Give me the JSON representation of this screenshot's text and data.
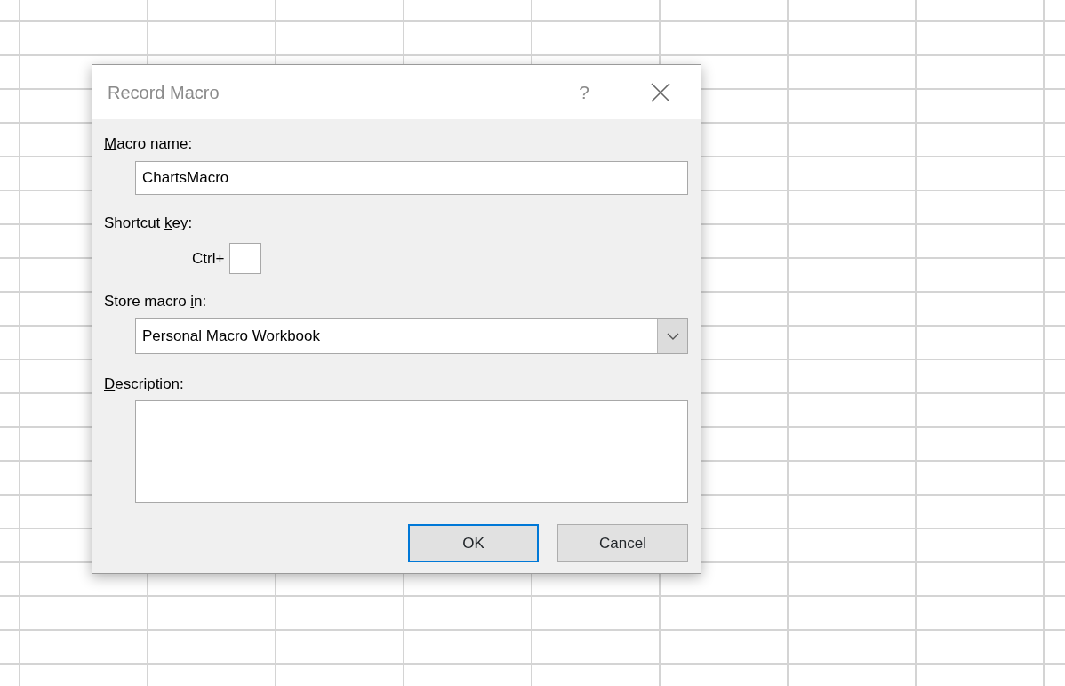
{
  "window": {
    "title": "Record Macro",
    "help": "?"
  },
  "fields": [
    {
      "kind": "text",
      "label": {
        "key": "M",
        "after": "acro name:"
      },
      "value": "ChartsMacro"
    },
    {
      "kind": "shortcut",
      "label": {
        "before": "Shortcut ",
        "key": "k",
        "after": "ey:"
      },
      "prefix": "Ctrl+"
    },
    {
      "kind": "select",
      "label": {
        "before": "Store macro ",
        "key": "i",
        "after": "n:"
      },
      "value": "Personal Macro Workbook"
    },
    {
      "kind": "textarea",
      "label": {
        "key": "D",
        "after": "escription:"
      }
    }
  ],
  "buttons": [
    {
      "label": "OK",
      "default": true
    },
    {
      "label": "Cancel",
      "default": false
    }
  ]
}
